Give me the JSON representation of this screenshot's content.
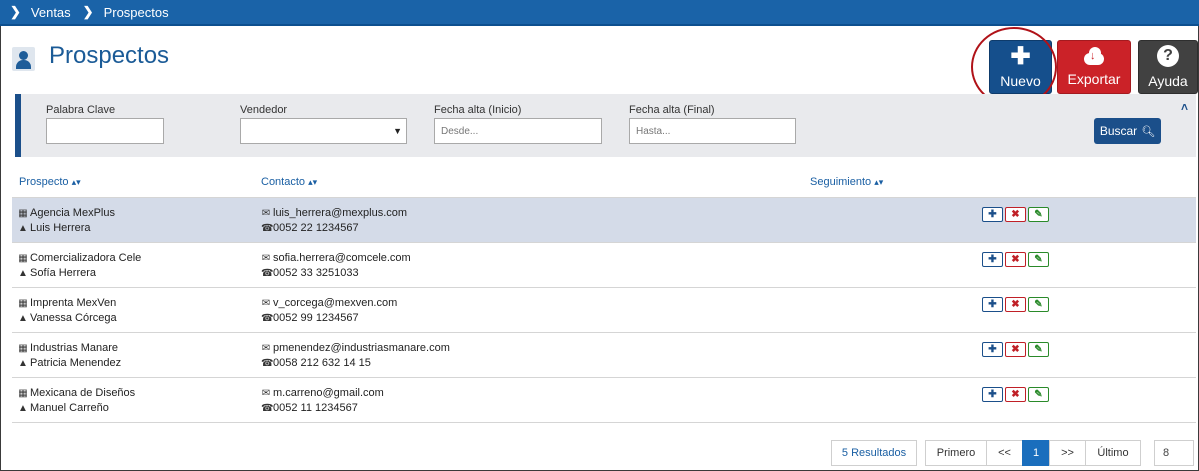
{
  "breadcrumb": {
    "items": [
      "Ventas",
      "Prospectos"
    ]
  },
  "page": {
    "title": "Prospectos"
  },
  "actions": {
    "nuevo": "Nuevo",
    "exportar": "Exportar",
    "ayuda": "Ayuda"
  },
  "filters": {
    "keyword_label": "Palabra Clave",
    "keyword_value": "",
    "seller_label": "Vendedor",
    "seller_value": "",
    "date_start_label": "Fecha alta (Inicio)",
    "date_start_placeholder": "Desde...",
    "date_end_label": "Fecha alta (Final)",
    "date_end_placeholder": "Hasta...",
    "search_label": "Buscar"
  },
  "table": {
    "headers": {
      "prospect": "Prospecto",
      "contact": "Contacto",
      "followup": "Seguimiento"
    },
    "rows": [
      {
        "company": "Agencia MexPlus",
        "person": "Luis Herrera",
        "email": "luis_herrera@mexplus.com",
        "phone": "0052 22 1234567"
      },
      {
        "company": "Comercializadora Cele",
        "person": "Sofía Herrera",
        "email": "sofia.herrera@comcele.com",
        "phone": "0052 33 3251033"
      },
      {
        "company": "Imprenta MexVen",
        "person": "Vanessa Córcega",
        "email": "v_corcega@mexven.com",
        "phone": "0052 99 1234567"
      },
      {
        "company": "Industrias Manare",
        "person": "Patricia Menendez",
        "email": "pmenendez@industriasmanare.com",
        "phone": "0058 212 632 14 15"
      },
      {
        "company": "Mexicana de Diseños",
        "person": "Manuel Carreño",
        "email": "m.carreno@gmail.com",
        "phone": "0052 11 1234567"
      }
    ]
  },
  "pagination": {
    "results": "5 Resultados",
    "first": "Primero",
    "prev": "<<",
    "current": "1",
    "next": ">>",
    "last": "Último",
    "page_size": "8"
  },
  "colors": {
    "brand": "#1b4f8a",
    "danger": "#cb2228",
    "selected_row": "#d4dbe8"
  }
}
